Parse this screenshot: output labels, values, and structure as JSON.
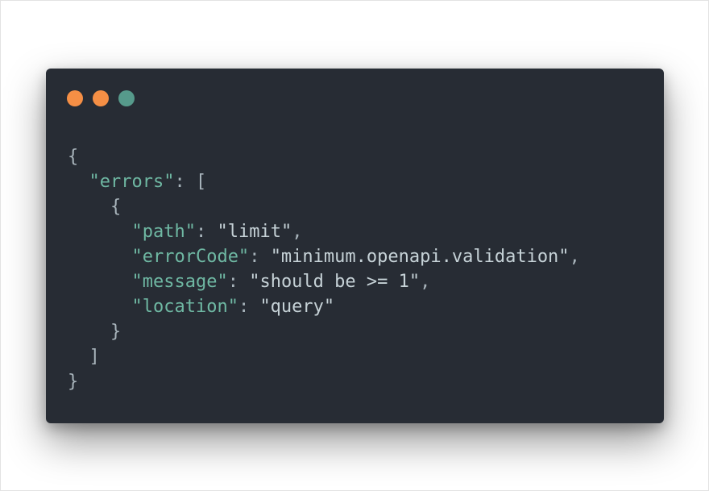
{
  "window": {
    "controls": [
      {
        "name": "close-dot",
        "color": "#f58f45"
      },
      {
        "name": "minimize-dot",
        "color": "#f58f45"
      },
      {
        "name": "zoom-dot",
        "color": "#569a8b"
      }
    ]
  },
  "code": {
    "colors": {
      "background": "#272c34",
      "key": "#6fb8a3",
      "string": "#c6d2d7",
      "punctuation": "#a8b4bb"
    },
    "lines": [
      {
        "tokens": [
          {
            "t": "punct",
            "v": "{"
          }
        ]
      },
      {
        "tokens": [
          {
            "t": "ws",
            "v": "  "
          },
          {
            "t": "key",
            "v": "\"errors\""
          },
          {
            "t": "punct",
            "v": ": ["
          }
        ]
      },
      {
        "tokens": [
          {
            "t": "ws",
            "v": "    "
          },
          {
            "t": "punct",
            "v": "{"
          }
        ]
      },
      {
        "tokens": [
          {
            "t": "ws",
            "v": "      "
          },
          {
            "t": "key",
            "v": "\"path\""
          },
          {
            "t": "punct",
            "v": ": "
          },
          {
            "t": "str",
            "v": "\"limit\""
          },
          {
            "t": "punct",
            "v": ","
          }
        ]
      },
      {
        "tokens": [
          {
            "t": "ws",
            "v": "      "
          },
          {
            "t": "key",
            "v": "\"errorCode\""
          },
          {
            "t": "punct",
            "v": ": "
          },
          {
            "t": "str",
            "v": "\"minimum.openapi.validation\""
          },
          {
            "t": "punct",
            "v": ","
          }
        ]
      },
      {
        "tokens": [
          {
            "t": "ws",
            "v": "      "
          },
          {
            "t": "key",
            "v": "\"message\""
          },
          {
            "t": "punct",
            "v": ": "
          },
          {
            "t": "str",
            "v": "\"should be >= 1\""
          },
          {
            "t": "punct",
            "v": ","
          }
        ]
      },
      {
        "tokens": [
          {
            "t": "ws",
            "v": "      "
          },
          {
            "t": "key",
            "v": "\"location\""
          },
          {
            "t": "punct",
            "v": ": "
          },
          {
            "t": "str",
            "v": "\"query\""
          }
        ]
      },
      {
        "tokens": [
          {
            "t": "ws",
            "v": "    "
          },
          {
            "t": "punct",
            "v": "}"
          }
        ]
      },
      {
        "tokens": [
          {
            "t": "ws",
            "v": "  "
          },
          {
            "t": "punct",
            "v": "]"
          }
        ]
      },
      {
        "tokens": [
          {
            "t": "punct",
            "v": "}"
          }
        ]
      }
    ]
  }
}
